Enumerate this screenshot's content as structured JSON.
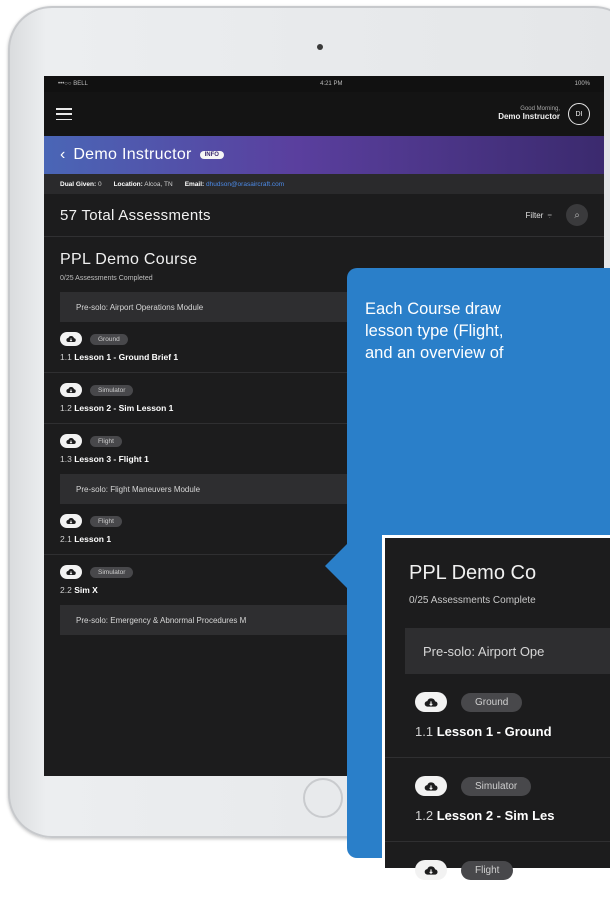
{
  "status": {
    "carrier": "•••○○ BELL",
    "time": "4:21 PM",
    "battery": "100%"
  },
  "topbar": {
    "greeting": "Good Morning,",
    "user": "Demo Instructor",
    "initials": "DI"
  },
  "profile": {
    "back": "‹",
    "name": "Demo Instructor",
    "badge": "INFO"
  },
  "info": {
    "dual_label": "Dual Given:",
    "dual_value": "0",
    "location_label": "Location:",
    "location_value": "Alcoa, TN",
    "email_label": "Email:",
    "email_value": "dhudson@orasaircraft.com"
  },
  "assessments": {
    "title": "57 Total Assessments",
    "filter": "Filter",
    "filter_icon": "filter-icon",
    "search_icon": "search-icon"
  },
  "course": {
    "title": "PPL Demo Course",
    "progress": "0/25 Assessments Completed"
  },
  "modules": [
    {
      "title": "Pre-solo: Airport Operations Module"
    },
    {
      "title": "Pre-solo: Flight Maneuvers Module"
    },
    {
      "title": "Pre-solo: Emergency & Abnormal Procedures M"
    }
  ],
  "lessons": [
    {
      "type": "Ground",
      "number": "1.1",
      "name": "Lesson 1 - Ground Brief 1"
    },
    {
      "type": "Simulator",
      "number": "1.2",
      "name": "Lesson 2 - Sim Lesson 1"
    },
    {
      "type": "Flight",
      "number": "1.3",
      "name": "Lesson 3 - Flight 1"
    },
    {
      "type": "Flight",
      "number": "2.1",
      "name": "Lesson 1"
    },
    {
      "type": "Simulator",
      "number": "2.2",
      "name": "Sim X"
    }
  ],
  "callout": {
    "line1": "Each Course draw",
    "line2": "lesson type (Flight,",
    "line3": "and an overview of",
    "zoom": {
      "title": "PPL Demo Co",
      "progress": "0/25 Assessments Complete",
      "module": "Pre-solo: Airport Ope",
      "lesson1_type": "Ground",
      "lesson1_number": "1.1",
      "lesson1_name": "Lesson 1 - Ground",
      "lesson2_type": "Simulator",
      "lesson2_number": "1.2",
      "lesson2_name": "Lesson 2 - Sim Les",
      "lesson3_type": "Flight"
    }
  },
  "colors": {
    "accent": "#2a7fc9",
    "header_start": "#4a66b6",
    "header_end": "#3b2a6e",
    "background": "#1c1c1d"
  }
}
